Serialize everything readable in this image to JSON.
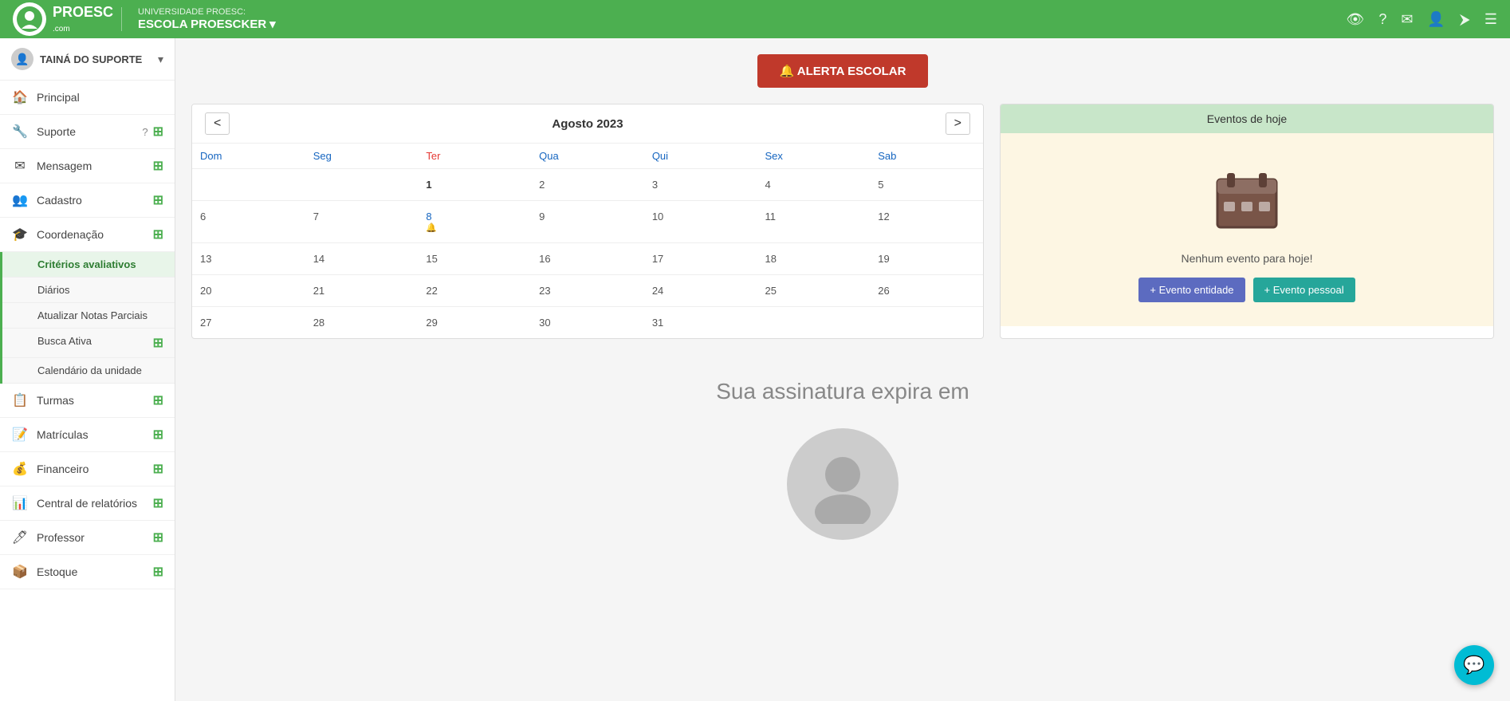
{
  "header": {
    "university_label": "UNIVERSIDADE PROESC:",
    "school_name": "ESCOLA PROESCKER",
    "logo_main": "PROESC",
    "logo_sub": ".com",
    "icons": [
      "view-icon",
      "help-icon",
      "mail-icon",
      "user-icon",
      "logout-icon",
      "menu-icon"
    ]
  },
  "sidebar": {
    "user": {
      "name": "TAINÁ DO SUPORTE",
      "chevron": "▾"
    },
    "items": [
      {
        "label": "Principal",
        "icon": "home-icon",
        "has_plus": false,
        "has_help": false,
        "expanded": false
      },
      {
        "label": "Suporte",
        "icon": "support-icon",
        "has_plus": true,
        "has_help": true,
        "expanded": false
      },
      {
        "label": "Mensagem",
        "icon": "message-icon",
        "has_plus": true,
        "has_help": false,
        "expanded": false
      },
      {
        "label": "Cadastro",
        "icon": "cadastro-icon",
        "has_plus": true,
        "has_help": false,
        "expanded": false
      },
      {
        "label": "Coordenação",
        "icon": "coord-icon",
        "has_plus": true,
        "has_help": false,
        "expanded": true
      },
      {
        "label": "Turmas",
        "icon": "turmas-icon",
        "has_plus": true,
        "has_help": false,
        "expanded": false
      },
      {
        "label": "Matrículas",
        "icon": "matriculas-icon",
        "has_plus": true,
        "has_help": false,
        "expanded": false
      },
      {
        "label": "Financeiro",
        "icon": "financeiro-icon",
        "has_plus": true,
        "has_help": false,
        "expanded": false
      },
      {
        "label": "Central de relatórios",
        "icon": "relatorios-icon",
        "has_plus": true,
        "has_help": false,
        "expanded": false
      },
      {
        "label": "Professor",
        "icon": "professor-icon",
        "has_plus": true,
        "has_help": false,
        "expanded": false
      },
      {
        "label": "Estoque",
        "icon": "estoque-icon",
        "has_plus": true,
        "has_help": false,
        "expanded": false
      }
    ],
    "submenu": [
      {
        "label": "Critérios avaliativos",
        "active": true
      },
      {
        "label": "Diários",
        "active": false
      },
      {
        "label": "Atualizar Notas Parciais",
        "active": false
      },
      {
        "label": "Busca Ativa",
        "active": false,
        "has_plus": true
      },
      {
        "label": "Calendário da unidade",
        "active": false
      }
    ]
  },
  "alert_button": {
    "label": "🔔 ALERTA ESCOLAR"
  },
  "calendar": {
    "title": "Agosto 2023",
    "prev_btn": "<",
    "next_btn": ">",
    "weekdays": [
      "Dom",
      "Seg",
      "Ter",
      "Qua",
      "Qui",
      "Sex",
      "Sab"
    ],
    "weeks": [
      [
        "",
        "",
        "1",
        "2",
        "3",
        "4",
        "5"
      ],
      [
        "6",
        "7",
        "8",
        "9",
        "10",
        "11",
        "12"
      ],
      [
        "13",
        "14",
        "15",
        "16",
        "17",
        "18",
        "19"
      ],
      [
        "20",
        "21",
        "22",
        "23",
        "24",
        "25",
        "26"
      ],
      [
        "27",
        "28",
        "29",
        "30",
        "31",
        "",
        ""
      ]
    ],
    "today_day": "8",
    "event_day": "8"
  },
  "events_panel": {
    "header": "Eventos de hoje",
    "no_events_text": "Nenhum evento para hoje!",
    "btn_entity": "+ Evento entidade",
    "btn_personal": "+ Evento pessoal"
  },
  "subscription": {
    "title": "Sua assinatura expira em"
  },
  "chat_bubble": {
    "icon": "💬"
  }
}
